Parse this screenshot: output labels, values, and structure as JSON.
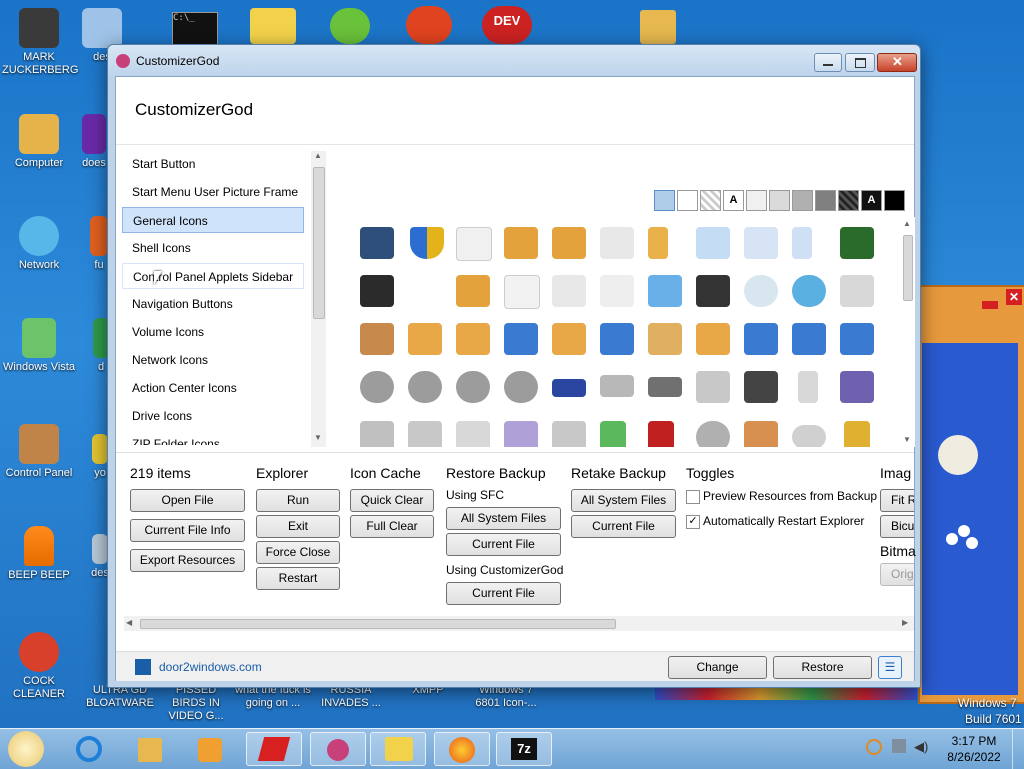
{
  "desktop": {
    "icons": [
      {
        "label": "MARK ZUCKERBERG"
      },
      {
        "label": "des"
      },
      {
        "label": "Computer"
      },
      {
        "label": "does"
      },
      {
        "label": "Network"
      },
      {
        "label": "fu"
      },
      {
        "label": "Windows Vista"
      },
      {
        "label": "d"
      },
      {
        "label": "Control Panel"
      },
      {
        "label": "yo"
      },
      {
        "label": "BEEP BEEP"
      },
      {
        "label": "des"
      },
      {
        "label": "COCK CLEANER"
      },
      {
        "label": "ULTRA GD BLOATWARE"
      },
      {
        "label": "PISSED BIRDS IN VIDEO G..."
      },
      {
        "label": "what the fuck is going on ..."
      },
      {
        "label": "RUSSIA INVADES ..."
      },
      {
        "label": "XMPP"
      },
      {
        "label": "Windows 7 6801 Icon-..."
      }
    ],
    "watermark_line1": "Windows 7",
    "watermark_line2": "Build 7601"
  },
  "window": {
    "title": "CustomizerGod",
    "header_title": "CustomizerGod",
    "categories": [
      {
        "label": "Start Button"
      },
      {
        "label": "Start Menu User Picture Frame"
      },
      {
        "label": "General Icons"
      },
      {
        "label": "Shell Icons"
      },
      {
        "label": "Control Panel Applets Sidebar"
      },
      {
        "label": "Navigation Buttons"
      },
      {
        "label": "Volume Icons"
      },
      {
        "label": "Network Icons"
      },
      {
        "label": "Action Center Icons"
      },
      {
        "label": "Drive Icons"
      },
      {
        "label": "ZIP Folder Icons"
      }
    ],
    "selected_category": "General Icons",
    "swatch_letter": "A",
    "item_count": "219 items",
    "file_buttons": [
      "Open File",
      "Current File Info",
      "Export Resources"
    ],
    "explorer": {
      "heading": "Explorer",
      "buttons": [
        "Run",
        "Exit",
        "Force Close",
        "Restart"
      ]
    },
    "icon_cache": {
      "heading": "Icon Cache",
      "buttons": [
        "Quick Clear",
        "Full Clear"
      ]
    },
    "restore_backup": {
      "heading": "Restore Backup",
      "using_sfc": "Using SFC",
      "sfc_buttons": [
        "All System Files",
        "Current File"
      ],
      "using_cg": "Using CustomizerGod",
      "cg_button": "Current File"
    },
    "retake_backup": {
      "heading": "Retake Backup",
      "buttons": [
        "All System Files",
        "Current File"
      ]
    },
    "toggles": {
      "heading": "Toggles",
      "preview": "Preview Resources from Backup",
      "preview_checked": false,
      "restart": "Automatically Restart Explorer",
      "restart_checked": true
    },
    "image": {
      "heading": "Imag",
      "fit": "Fit R",
      "bicubic": "Bicu",
      "bitmap": "Bitma",
      "orig": "Orig"
    },
    "footer": {
      "link": "door2windows.com",
      "change": "Change",
      "restore": "Restore"
    }
  },
  "taskbar": {
    "time": "3:17 PM",
    "date": "8/26/2022",
    "cmd_caption": "C:\\_",
    "dev_caption": "DEV"
  }
}
